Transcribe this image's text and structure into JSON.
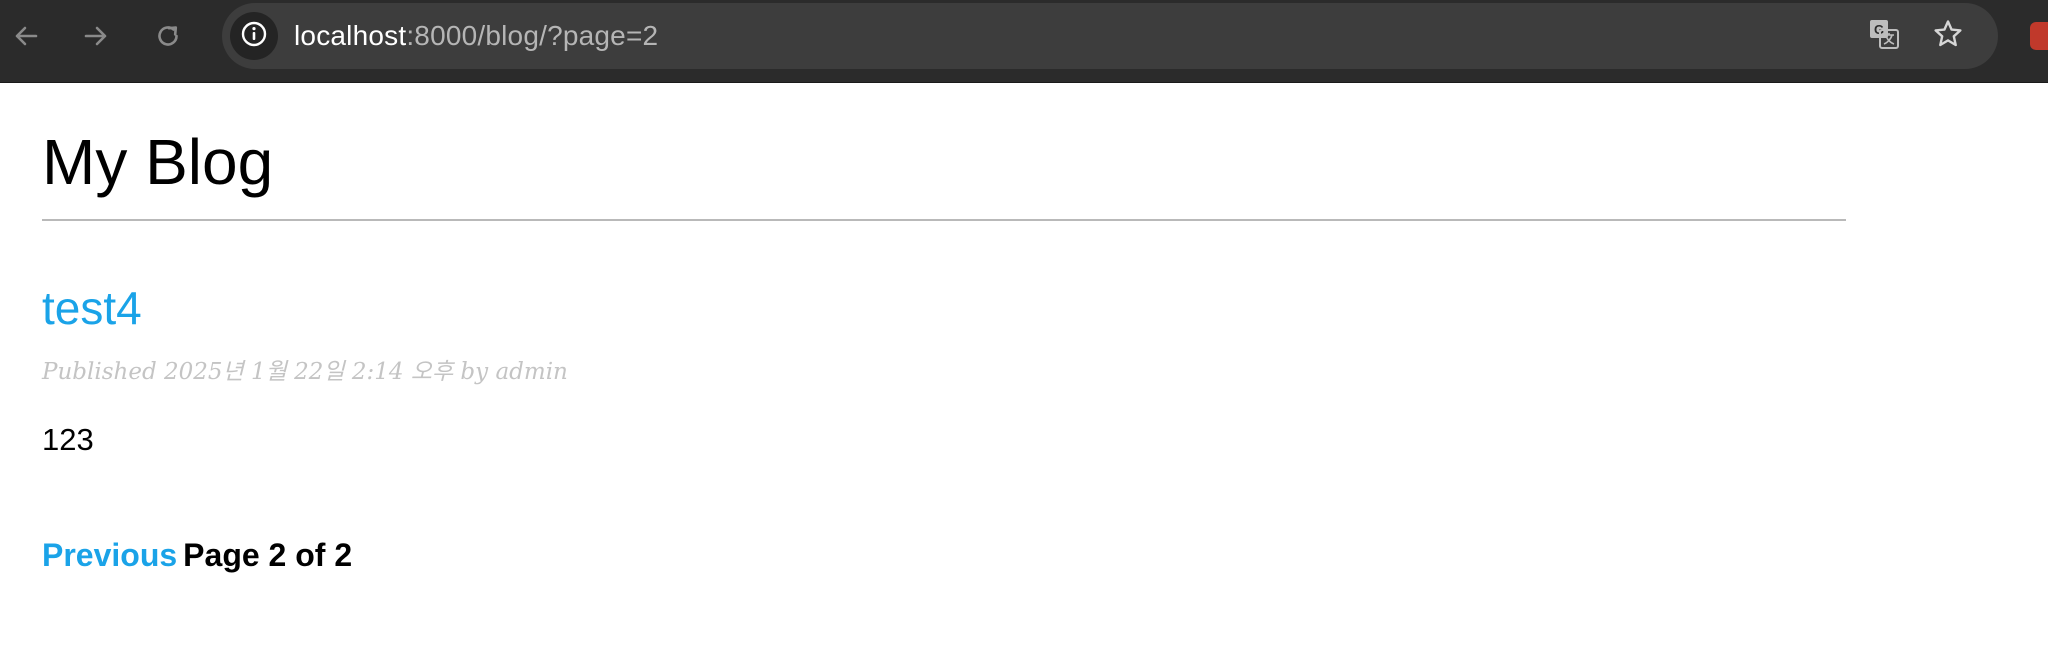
{
  "browser": {
    "url_host": "localhost",
    "url_path": ":8000/blog/?page=2",
    "icons": {
      "back": "arrow-left-icon",
      "forward": "arrow-right-icon",
      "reload": "reload-icon",
      "site_info": "info-icon",
      "translate": "translate-icon",
      "bookmark": "star-icon",
      "extension": "extension-icon"
    },
    "colors": {
      "toolbar": "#2b2b2b",
      "omnibox": "#3d3d3d",
      "url_host": "#ffffff",
      "url_path": "#b5b5b5"
    }
  },
  "page": {
    "blog_title": "My Blog",
    "posts": [
      {
        "title": "test4",
        "meta": "Published 2025년 1월 22일 2:14 오후 by admin",
        "body": "123"
      }
    ],
    "pagination": {
      "previous_label": "Previous",
      "status": "Page 2 of 2"
    },
    "colors": {
      "link": "#1aa3e8",
      "meta": "#c4c4c4",
      "divider": "#b9b9b9"
    }
  }
}
